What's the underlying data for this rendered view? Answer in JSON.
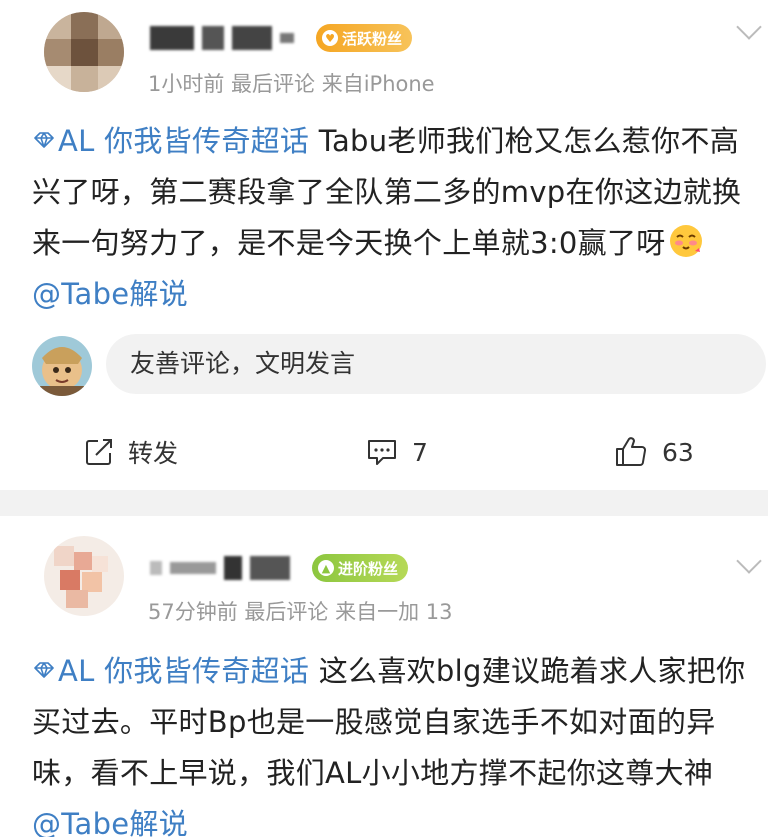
{
  "posts": [
    {
      "badge": "活跃粉丝",
      "meta": "1小时前  最后评论  来自iPhone",
      "topic": "AL 你我皆传奇超话",
      "text": " Tabu老师我们枪又怎么惹你不高兴了呀，第二赛段拿了全队第二多的mvp在你这边就换来一句努力了，是不是今天换个上单就3:0赢了呀",
      "mention": "@Tabe解说",
      "comment_placeholder": "友善评论，文明发言",
      "repost_label": "转发",
      "comment_count": "7",
      "like_count": "63"
    },
    {
      "badge": "进阶粉丝",
      "meta": "57分钟前  最后评论  来自一加 13",
      "topic": "AL 你我皆传奇超话",
      "text": " 这么喜欢blg建议跪着求人家把你买过去。平时Bp也是一股感觉自家选手不如对面的异味，看不上早说，我们AL小小地方撑不起你这尊大神",
      "mention": "@Tabe解说"
    }
  ],
  "icons": [
    "topic-diamond-icon",
    "emoji-icon",
    "repost-icon",
    "comment-icon",
    "like-icon",
    "chevron-down-icon"
  ],
  "colors": {
    "link": "#3f7fc4",
    "badge_orange": "#f5a623",
    "badge_green": "#8cc63f",
    "meta": "#999999",
    "input_bg": "#f2f2f2"
  }
}
